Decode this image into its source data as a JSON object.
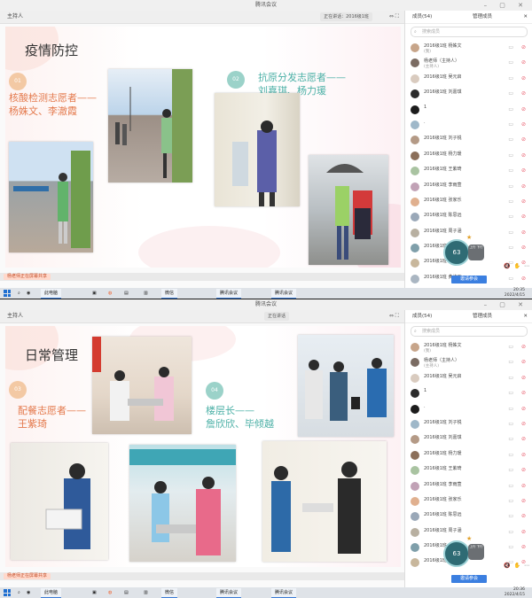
{
  "screens": [
    {
      "window_title": "腾讯会议",
      "presenter": "主持人",
      "room_tag": "正在讲话：2016级1班",
      "slide": {
        "title": "疫情防控",
        "block1": {
          "badge": "01",
          "heading": "核酸检测志愿者——",
          "names": "杨姝文、李澈霞"
        },
        "block2": {
          "badge": "02",
          "heading": "抗原分发志愿者——",
          "names": "刘嘉琪、杨力瑗"
        }
      },
      "sidebar": {
        "tab_members": "成员(54)",
        "tab_manage": "管理成员",
        "search_placeholder": "搜索成员",
        "participants": [
          {
            "name": "2016级1班 杨姝文",
            "sub": "(我)"
          },
          {
            "name": "杨老师（主持人）",
            "sub": "(主持人)"
          },
          {
            "name": "2016级1班 吴元启",
            "sub": ""
          },
          {
            "name": "2016级1班 刘嘉琪",
            "sub": ""
          },
          {
            "name": "1",
            "sub": ""
          },
          {
            "name": ".",
            "sub": ""
          },
          {
            "name": "2016级1班 刘子锐",
            "sub": ""
          },
          {
            "name": "2016级1班 杨力瑗",
            "sub": ""
          },
          {
            "name": "2016级1班 王紫琦",
            "sub": ""
          },
          {
            "name": "2016级1班 李雨萱",
            "sub": ""
          },
          {
            "name": "2016级1班 张家乐",
            "sub": ""
          },
          {
            "name": "2016级1班 陈思远",
            "sub": ""
          },
          {
            "name": "2016级1班 周子涵",
            "sub": ""
          },
          {
            "name": "2016级1班 王梓萌",
            "sub": ""
          },
          {
            "name": "2016级1班 马浩然",
            "sub": ""
          },
          {
            "name": "2016级1班 黄诗雨",
            "sub": ""
          }
        ],
        "invite_button": "邀请参会",
        "network_score": "63",
        "network_stats": "上行 下行"
      },
      "share_label": "杨老师正在屏幕共享",
      "taskbar": {
        "tasks": [
          "此电脑",
          "微信",
          "腾讯会议",
          "腾讯会议"
        ],
        "time": "20:35",
        "date": "2022/4/15"
      }
    },
    {
      "window_title": "腾讯会议",
      "presenter": "主持人",
      "room_tag": "正在讲话",
      "slide": {
        "title": "日常管理",
        "block1": {
          "badge": "03",
          "heading": "配餐志愿者——",
          "names": "王紫琦"
        },
        "block2": {
          "badge": "04",
          "heading": "楼层长——",
          "names": "詹欣欣、毕倾越"
        }
      },
      "sidebar": {
        "tab_members": "成员(54)",
        "tab_manage": "管理成员",
        "search_placeholder": "搜索成员",
        "participants": [
          {
            "name": "2016级1班 杨姝文",
            "sub": "(我)"
          },
          {
            "name": "杨老师（主持人）",
            "sub": "(主持人)"
          },
          {
            "name": "2016级1班 吴元启",
            "sub": ""
          },
          {
            "name": "1",
            "sub": ""
          },
          {
            "name": ".",
            "sub": ""
          },
          {
            "name": "2016级1班 刘子锐",
            "sub": ""
          },
          {
            "name": "2016级1班 刘嘉琪",
            "sub": ""
          },
          {
            "name": "2016级1班 杨力瑗",
            "sub": ""
          },
          {
            "name": "2016级1班 王紫琦",
            "sub": ""
          },
          {
            "name": "2016级1班 李雨萱",
            "sub": ""
          },
          {
            "name": "2016级1班 张家乐",
            "sub": ""
          },
          {
            "name": "2016级1班 陈思远",
            "sub": ""
          },
          {
            "name": "2016级1班 周子涵",
            "sub": ""
          },
          {
            "name": "2016级1班 王梓萌",
            "sub": ""
          },
          {
            "name": "2016级1班 马浩然",
            "sub": ""
          }
        ],
        "invite_button": "邀请参会",
        "network_score": "63",
        "network_stats": "上行 下行"
      },
      "share_label": "杨老师正在屏幕共享",
      "taskbar": {
        "tasks": [
          "此电脑",
          "微信",
          "腾讯会议",
          "腾讯会议"
        ],
        "time": "20:36",
        "date": "2022/4/15"
      }
    }
  ],
  "colors": {
    "accent_orange": "#e4794c",
    "accent_teal": "#4bb0a6",
    "invite_blue": "#3b7fe0",
    "mic_red": "#e85a6a"
  }
}
